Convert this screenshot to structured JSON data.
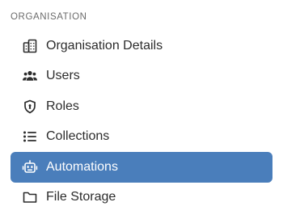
{
  "sidebar": {
    "section_title": "ORGANISATION",
    "active_index": 4,
    "items": [
      {
        "label": "Organisation Details",
        "icon": "building-icon"
      },
      {
        "label": "Users",
        "icon": "users-icon"
      },
      {
        "label": "Roles",
        "icon": "shield-icon"
      },
      {
        "label": "Collections",
        "icon": "list-icon"
      },
      {
        "label": "Automations",
        "icon": "robot-icon"
      },
      {
        "label": "File Storage",
        "icon": "folder-icon"
      }
    ]
  },
  "colors": {
    "active_background": "#4a7ebb",
    "active_text": "#ffffff",
    "text": "#2c2c2c",
    "section_title": "#6b6b6b"
  }
}
